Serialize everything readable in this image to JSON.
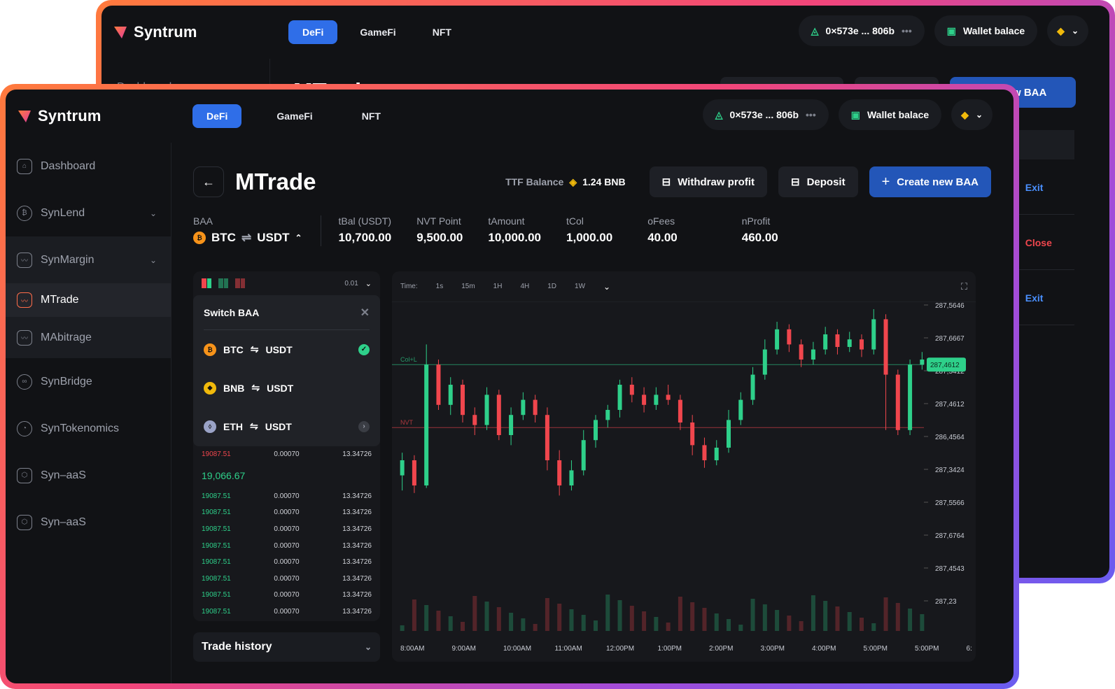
{
  "app": {
    "brand": "Syntrum"
  },
  "nav": {
    "tabs": [
      "DeFi",
      "GameFi",
      "NFT"
    ],
    "active": 0
  },
  "wallet": {
    "address": "0×573e ... 806b",
    "balance_label": "Wallet balace"
  },
  "colors": {
    "accent": "#2f6ee8",
    "up": "#2ed08a",
    "down": "#f0464d",
    "bg": "#111215"
  },
  "back_window": {
    "title_fragment": "MTrade",
    "create_label_fragment": "te new BAA",
    "nav_fragment": "Dashboard",
    "row_actions": [
      "Exit",
      "Close",
      "Exit"
    ]
  },
  "sidebar": {
    "items": [
      {
        "label": "Dashboard",
        "icon": "home-icon"
      },
      {
        "label": "SynLend",
        "icon": "coin-icon",
        "chevron": true
      },
      {
        "label": "SynMargin",
        "icon": "chart-icon",
        "chevron": true
      },
      {
        "label": "MTrade",
        "icon": "chart-icon"
      },
      {
        "label": "MAbitrage",
        "icon": "chart-icon"
      },
      {
        "label": "SynBridge",
        "icon": "bridge-icon"
      },
      {
        "label": "SynTokenomics",
        "icon": "pie-icon"
      },
      {
        "label": "Syn–aaS",
        "icon": "cube-icon"
      },
      {
        "label": "Syn–aaS",
        "icon": "cube-icon"
      }
    ]
  },
  "page": {
    "title": "MTrade",
    "ttf_label": "TTF Balance",
    "ttf_value": "1.24 BNB",
    "withdraw_label": "Withdraw profit",
    "deposit_label": "Deposit",
    "create_label": "Create new BAA"
  },
  "stats": {
    "baa_label": "BAA",
    "baa_base": "BTC",
    "baa_quote": "USDT",
    "items": [
      {
        "k": "tBal (USDT)",
        "v": "10,700.00"
      },
      {
        "k": "NVT Point",
        "v": "9,500.00"
      },
      {
        "k": "tAmount",
        "v": "10,000.00"
      },
      {
        "k": "tCol",
        "v": "1,000.00"
      },
      {
        "k": "oFees",
        "v": "40.00"
      },
      {
        "k": "nProfit",
        "v": "460.00"
      }
    ]
  },
  "orderbook": {
    "precision": "0.01",
    "switch_title": "Switch BAA",
    "pairs": [
      {
        "base": "BTC",
        "quote": "USDT",
        "selected": true
      },
      {
        "base": "BNB",
        "quote": "USDT",
        "selected": false
      },
      {
        "base": "ETH",
        "quote": "USDT",
        "selected": false
      }
    ],
    "ask_row": {
      "price": "19087.51",
      "amount": "0.00070",
      "total": "13.34726"
    },
    "mid_price": "19,066.67",
    "bid_rows": [
      {
        "price": "19087.51",
        "amount": "0.00070",
        "total": "13.34726"
      },
      {
        "price": "19087.51",
        "amount": "0.00070",
        "total": "13.34726"
      },
      {
        "price": "19087.51",
        "amount": "0.00070",
        "total": "13.34726"
      },
      {
        "price": "19087.51",
        "amount": "0.00070",
        "total": "13.34726"
      },
      {
        "price": "19087.51",
        "amount": "0.00070",
        "total": "13.34726"
      },
      {
        "price": "19087.51",
        "amount": "0.00070",
        "total": "13.34726"
      },
      {
        "price": "19087.51",
        "amount": "0.00070",
        "total": "13.34726"
      },
      {
        "price": "19087.51",
        "amount": "0.00070",
        "total": "13.34726"
      }
    ],
    "trade_history_label": "Trade history"
  },
  "chart_data": {
    "type": "candlestick",
    "toolbar": {
      "time_label": "Time:",
      "intervals": [
        "1s",
        "15m",
        "1H",
        "4H",
        "1D",
        "1W"
      ]
    },
    "y_tick_labels": [
      "287,5646",
      "287,6667",
      "287,5412",
      "287,4612",
      "286,4564",
      "287,3424",
      "287,5566",
      "287,6764",
      "287,4543",
      "287,23"
    ],
    "x_tick_labels": [
      "8:00AM",
      "9:00AM",
      "10:00AM",
      "11:00AM",
      "12:00PM",
      "1:00PM",
      "2:00PM",
      "3:00PM",
      "4:00PM",
      "5:00PM",
      "5:00PM",
      "6:"
    ],
    "current_price_label": "287,4612",
    "lines": [
      {
        "name": "Col+L"
      },
      {
        "name": "NVT"
      }
    ],
    "candles": [
      {
        "o": 34,
        "c": 40,
        "h": 43,
        "l": 28
      },
      {
        "o": 40,
        "c": 30,
        "h": 42,
        "l": 27
      },
      {
        "o": 30,
        "c": 78,
        "h": 86,
        "l": 29
      },
      {
        "o": 78,
        "c": 62,
        "h": 80,
        "l": 60
      },
      {
        "o": 62,
        "c": 70,
        "h": 73,
        "l": 58
      },
      {
        "o": 70,
        "c": 58,
        "h": 72,
        "l": 55
      },
      {
        "o": 58,
        "c": 54,
        "h": 61,
        "l": 50
      },
      {
        "o": 54,
        "c": 66,
        "h": 69,
        "l": 52
      },
      {
        "o": 66,
        "c": 50,
        "h": 68,
        "l": 48
      },
      {
        "o": 50,
        "c": 58,
        "h": 61,
        "l": 46
      },
      {
        "o": 58,
        "c": 64,
        "h": 67,
        "l": 56
      },
      {
        "o": 64,
        "c": 58,
        "h": 66,
        "l": 55
      },
      {
        "o": 58,
        "c": 40,
        "h": 61,
        "l": 36
      },
      {
        "o": 40,
        "c": 30,
        "h": 44,
        "l": 26
      },
      {
        "o": 30,
        "c": 36,
        "h": 40,
        "l": 28
      },
      {
        "o": 36,
        "c": 48,
        "h": 52,
        "l": 34
      },
      {
        "o": 48,
        "c": 56,
        "h": 58,
        "l": 45
      },
      {
        "o": 56,
        "c": 60,
        "h": 62,
        "l": 53
      },
      {
        "o": 60,
        "c": 70,
        "h": 72,
        "l": 57
      },
      {
        "o": 70,
        "c": 66,
        "h": 73,
        "l": 63
      },
      {
        "o": 66,
        "c": 62,
        "h": 69,
        "l": 59
      },
      {
        "o": 62,
        "c": 66,
        "h": 69,
        "l": 60
      },
      {
        "o": 66,
        "c": 64,
        "h": 70,
        "l": 62
      },
      {
        "o": 64,
        "c": 55,
        "h": 66,
        "l": 52
      },
      {
        "o": 55,
        "c": 46,
        "h": 58,
        "l": 42
      },
      {
        "o": 46,
        "c": 40,
        "h": 49,
        "l": 37
      },
      {
        "o": 40,
        "c": 45,
        "h": 48,
        "l": 38
      },
      {
        "o": 45,
        "c": 56,
        "h": 60,
        "l": 43
      },
      {
        "o": 56,
        "c": 64,
        "h": 67,
        "l": 54
      },
      {
        "o": 64,
        "c": 74,
        "h": 77,
        "l": 62
      },
      {
        "o": 74,
        "c": 84,
        "h": 88,
        "l": 72
      },
      {
        "o": 84,
        "c": 92,
        "h": 95,
        "l": 82
      },
      {
        "o": 92,
        "c": 86,
        "h": 94,
        "l": 83
      },
      {
        "o": 86,
        "c": 80,
        "h": 88,
        "l": 77
      },
      {
        "o": 80,
        "c": 84,
        "h": 87,
        "l": 78
      },
      {
        "o": 84,
        "c": 90,
        "h": 93,
        "l": 82
      },
      {
        "o": 90,
        "c": 85,
        "h": 92,
        "l": 82
      },
      {
        "o": 85,
        "c": 88,
        "h": 91,
        "l": 83
      },
      {
        "o": 88,
        "c": 84,
        "h": 90,
        "l": 81
      },
      {
        "o": 84,
        "c": 96,
        "h": 100,
        "l": 82
      },
      {
        "o": 96,
        "c": 74,
        "h": 98,
        "l": 52
      },
      {
        "o": 74,
        "c": 52,
        "h": 76,
        "l": 50
      },
      {
        "o": 52,
        "c": 78,
        "h": 80,
        "l": 50
      },
      {
        "o": 78,
        "c": 80,
        "h": 83,
        "l": 76
      }
    ]
  }
}
